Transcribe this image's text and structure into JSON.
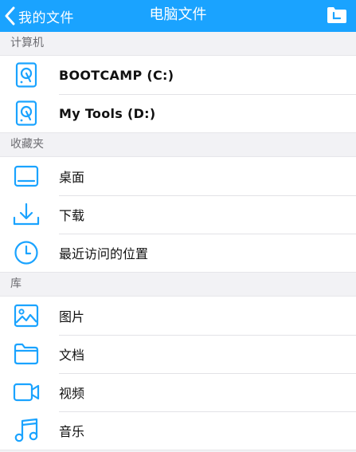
{
  "nav": {
    "back_label": "我的文件",
    "title": "电脑文件",
    "action_icon": "folder-icon"
  },
  "sections": {
    "computer": {
      "header": "计算机",
      "items": [
        {
          "label": "BOOTCAMP (C:)",
          "icon": "hard-drive-icon"
        },
        {
          "label": "My Tools (D:)",
          "icon": "hard-drive-icon"
        }
      ]
    },
    "favorites": {
      "header": "收藏夹",
      "items": [
        {
          "label": "桌面",
          "icon": "desktop-icon"
        },
        {
          "label": "下载",
          "icon": "download-icon"
        },
        {
          "label": "最近访问的位置",
          "icon": "clock-icon"
        }
      ]
    },
    "library": {
      "header": "库",
      "items": [
        {
          "label": "图片",
          "icon": "picture-icon"
        },
        {
          "label": "文档",
          "icon": "folder-icon"
        },
        {
          "label": "视频",
          "icon": "video-icon"
        },
        {
          "label": "音乐",
          "icon": "music-icon"
        }
      ]
    }
  },
  "colors": {
    "accent": "#1aa3ff",
    "background": "#f2f2f5",
    "section_text": "#6d6d72"
  }
}
